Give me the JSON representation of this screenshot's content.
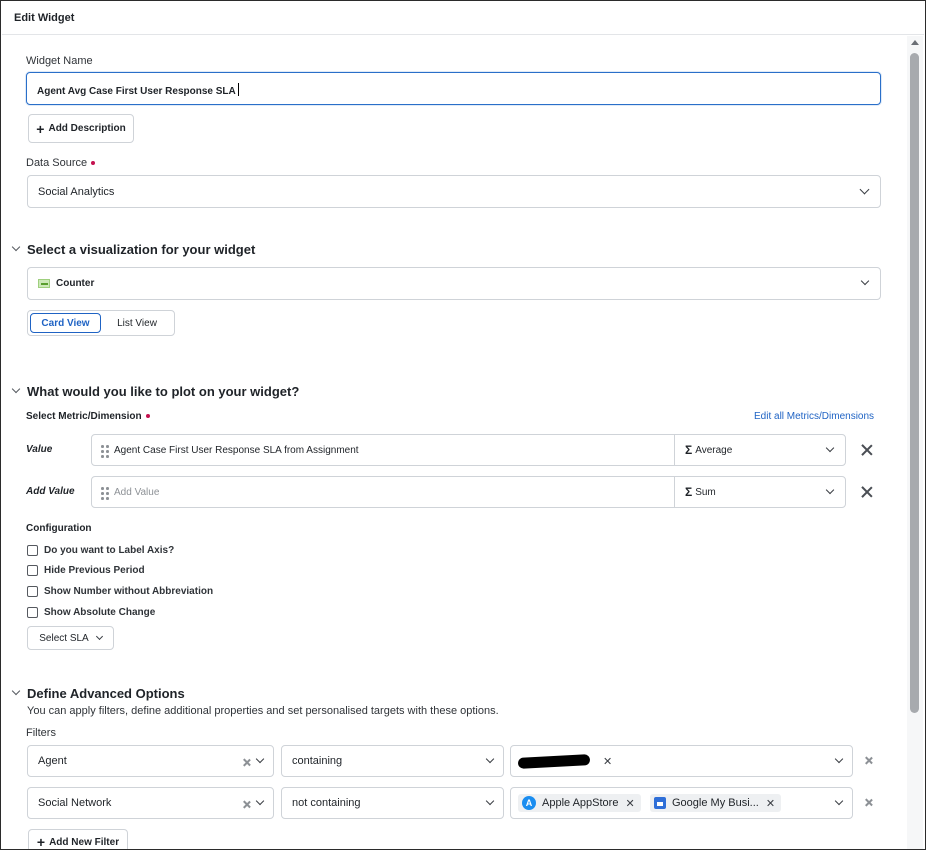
{
  "window": {
    "title": "Edit Widget"
  },
  "widget_name": {
    "label": "Widget Name",
    "value": "Agent Avg Case First User Response SLA"
  },
  "add_description_label": "Add Description",
  "data_source": {
    "label": "Data Source",
    "value": "Social Analytics"
  },
  "visualization": {
    "title": "Select a visualization for your widget",
    "type": "Counter",
    "views": [
      "Card View",
      "List View"
    ],
    "active_view": "Card View"
  },
  "plot": {
    "title": "What would you like to plot on your widget?",
    "metric_label": "Select Metric/Dimension",
    "edit_link": "Edit all Metrics/Dimensions",
    "rows": [
      {
        "label": "Value",
        "metric": "Agent Case First User Response SLA from Assignment",
        "aggregation": "Average"
      },
      {
        "label": "Add Value",
        "placeholder": "Add Value",
        "aggregation": "Sum"
      }
    ]
  },
  "configuration": {
    "title": "Configuration",
    "options": [
      {
        "label": "Do you want to Label Axis?",
        "checked": false
      },
      {
        "label": "Hide Previous Period",
        "checked": false
      },
      {
        "label": "Show Number without Abbreviation",
        "checked": false
      },
      {
        "label": "Show Absolute Change",
        "checked": false
      }
    ],
    "sla_button": "Select SLA"
  },
  "advanced": {
    "title": "Define Advanced Options",
    "description": "You can apply filters, define additional properties and set personalised targets with these options.",
    "filters_label": "Filters",
    "filters": [
      {
        "field": "Agent",
        "operator": "containing",
        "values": [
          "[redacted]"
        ]
      },
      {
        "field": "Social Network",
        "operator": "not containing",
        "values": [
          "Apple AppStore",
          "Google My Busi..."
        ]
      }
    ],
    "add_filter_label": "Add New Filter"
  },
  "colors": {
    "accent": "#1f63c4",
    "required": "#c4114f",
    "border": "#cfd3d8"
  },
  "icons": [
    "plus-icon",
    "chevron-down-icon",
    "drag-handle-icon",
    "sigma-icon",
    "close-icon",
    "counter-chart-icon",
    "apple-appstore-icon",
    "google-my-business-icon"
  ]
}
